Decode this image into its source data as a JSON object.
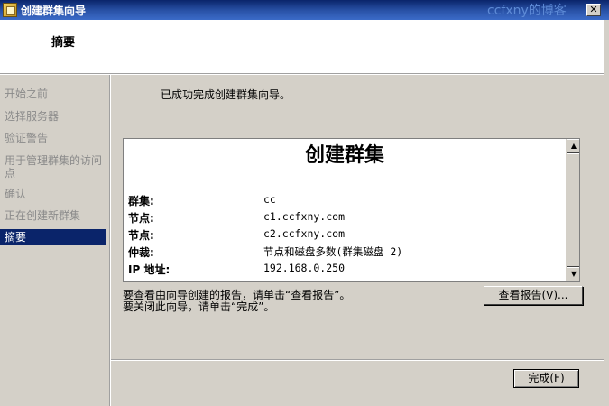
{
  "window": {
    "title": "创建群集向导",
    "close_symbol": "✕",
    "watermark": "ccfxny的博客"
  },
  "header": {
    "title": "摘要"
  },
  "sidebar": {
    "items": [
      {
        "label": "开始之前",
        "active": false
      },
      {
        "label": "选择服务器",
        "active": false
      },
      {
        "label": "验证警告",
        "active": false
      },
      {
        "label": "用于管理群集的访问点",
        "active": false
      },
      {
        "label": "确认",
        "active": false
      },
      {
        "label": "正在创建新群集",
        "active": false
      },
      {
        "label": "摘要",
        "active": true
      }
    ]
  },
  "main": {
    "success_text": "已成功完成创建群集向导。",
    "report": {
      "title": "创建群集",
      "rows": [
        {
          "label": "群集:",
          "value": "cc"
        },
        {
          "label": "节点:",
          "value": "c1.ccfxny.com"
        },
        {
          "label": "节点:",
          "value": "c2.ccfxny.com"
        },
        {
          "label": "仲裁:",
          "value": "节点和磁盘多数(群集磁盘 2)"
        },
        {
          "label": "IP 地址:",
          "value": "192.168.0.250"
        }
      ]
    },
    "instructions": [
      "要查看由向导创建的报告，请单击“查看报告”。",
      "要关闭此向导，请单击“完成”。"
    ],
    "view_report_button": "查看报告(V)...",
    "finish_button": "完成(F)"
  },
  "scroll_up_icon": "▲",
  "scroll_down_icon": "▼"
}
